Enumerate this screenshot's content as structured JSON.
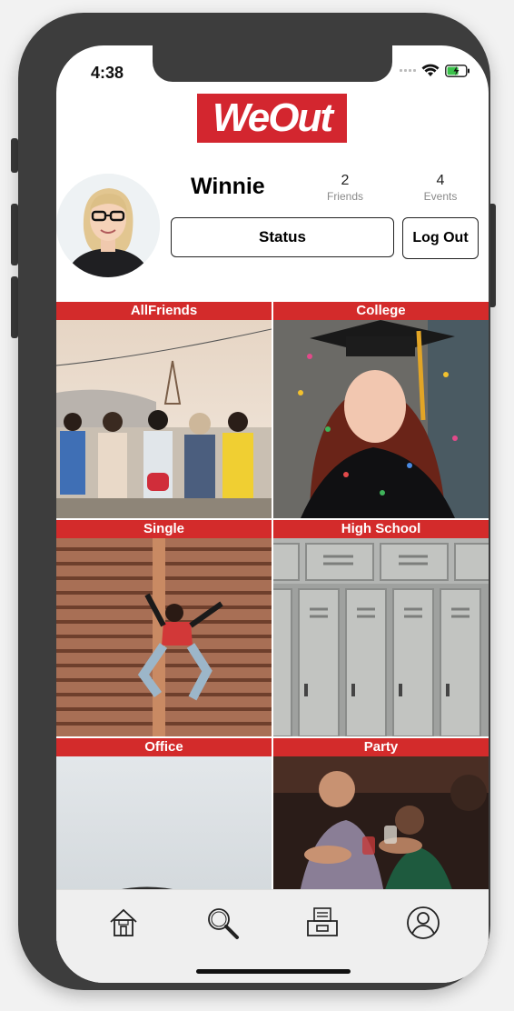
{
  "status_bar": {
    "time": "4:38"
  },
  "app": {
    "logo_text": "WeOut",
    "brand_color": "#d3262f"
  },
  "profile": {
    "name": "Winnie",
    "friends_count": "2",
    "friends_label": "Friends",
    "events_count": "4",
    "events_label": "Events",
    "status_button": "Status",
    "logout_button": "Log Out"
  },
  "groups": [
    {
      "label": "AllFriends"
    },
    {
      "label": "College"
    },
    {
      "label": "Single"
    },
    {
      "label": "High School"
    },
    {
      "label": "Office"
    },
    {
      "label": "Party"
    }
  ],
  "tab_bar": {
    "icons": [
      "home-icon",
      "search-icon",
      "inbox-icon",
      "profile-icon"
    ]
  }
}
